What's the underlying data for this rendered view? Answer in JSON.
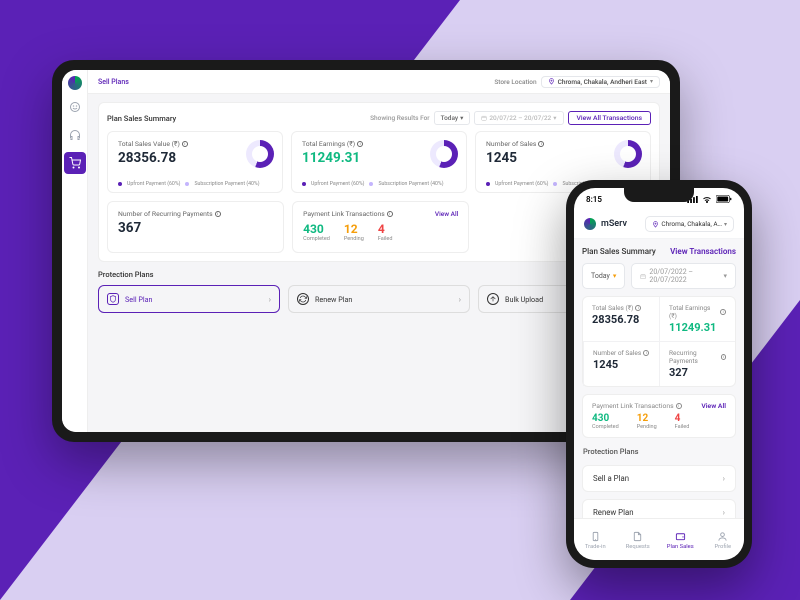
{
  "tablet": {
    "page_title": "Sell Plans",
    "store_location_label": "Store Location",
    "store_location": "Chroma, Chakala, Andheri East",
    "summary": {
      "title": "Plan Sales Summary",
      "showing_label": "Showing Results For",
      "period": "Today",
      "date_range": "20/07/22 – 20/07/22",
      "view_all": "View All Transactions",
      "cards": {
        "total_sales": {
          "label": "Total Sales Value (₹)",
          "value": "28356.78"
        },
        "total_earnings": {
          "label": "Total Earnings (₹)",
          "value": "11249.31"
        },
        "num_sales": {
          "label": "Number of Sales",
          "value": "1245"
        },
        "legend_upfront": "Upfront Payment (60%)",
        "legend_subscription": "Subscription Payment (40%)"
      },
      "recurring": {
        "label": "Number of Recurring Payments",
        "value": "367"
      },
      "plt": {
        "label": "Payment Link Transactions",
        "view_all": "View All",
        "completed": {
          "n": "430",
          "s": "Completed"
        },
        "pending": {
          "n": "12",
          "s": "Pending"
        },
        "failed": {
          "n": "4",
          "s": "Failed"
        }
      }
    },
    "protection": {
      "title": "Protection Plans",
      "sell": "Sell Plan",
      "renew": "Renew Plan",
      "bulk": "Bulk Upload"
    }
  },
  "phone": {
    "time": "8:15",
    "brand": "mServ",
    "location": "Chroma, Chakala, A…",
    "summary_title": "Plan Sales Summary",
    "view_transactions": "View Transactions",
    "period": "Today",
    "date_range": "20/07/2022 – 20/07/2022",
    "kpi": {
      "total_sales": {
        "label": "Total Sales (₹)",
        "value": "28356.78"
      },
      "total_earnings": {
        "label": "Total Earnings (₹)",
        "value": "11249.31"
      },
      "num_sales": {
        "label": "Number of Sales",
        "value": "1245"
      },
      "recurring": {
        "label": "Recurring Payments",
        "value": "327"
      }
    },
    "plt": {
      "label": "Payment Link Transactions",
      "view_all": "View All",
      "completed": {
        "n": "430",
        "s": "Completed"
      },
      "pending": {
        "n": "12",
        "s": "Pending"
      },
      "failed": {
        "n": "4",
        "s": "Failed"
      }
    },
    "protection_title": "Protection Plans",
    "sell_plan": "Sell a Plan",
    "renew_plan": "Renew Plan",
    "tabs": {
      "trade_in": "Trade-in",
      "requests": "Requests",
      "plan_sales": "Plan Sales",
      "profile": "Profile"
    }
  }
}
